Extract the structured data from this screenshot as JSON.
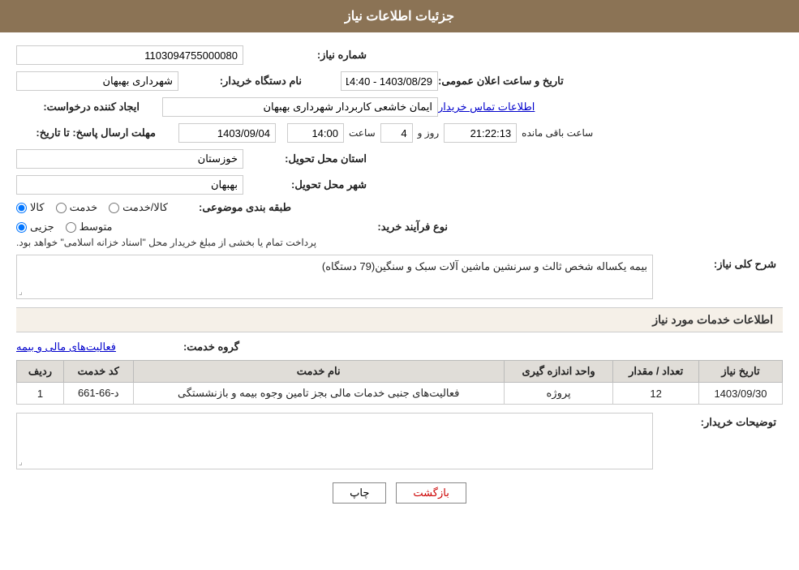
{
  "header": {
    "title": "جزئیات اطلاعات نیاز"
  },
  "fields": {
    "niaaz_number_label": "شماره نیاز:",
    "niaaz_number_value": "1103094755000080",
    "buyer_name_label": "نام دستگاه خریدار:",
    "buyer_name_value": "شهرداری بهبهان",
    "requester_label": "ایجاد کننده درخواست:",
    "requester_value": "ایمان خاشعی کاربردار شهرداری بهبهان",
    "requester_link": "اطلاعات تماس خریدار",
    "announce_date_label": "تاریخ و ساعت اعلان عمومی:",
    "announce_date_value": "1403/08/29 - 14:40",
    "response_deadline_label": "مهلت ارسال پاسخ: تا تاریخ:",
    "response_date_value": "1403/09/04",
    "response_time_label": "ساعت",
    "response_time_value": "14:00",
    "response_days_label": "روز و",
    "response_days_value": "4",
    "response_remaining_label": "ساعت باقی مانده",
    "response_remaining_value": "21:22:13",
    "delivery_province_label": "استان محل تحویل:",
    "delivery_province_value": "خوزستان",
    "delivery_city_label": "شهر محل تحویل:",
    "delivery_city_value": "بهبهان",
    "category_label": "طبقه بندی موضوعی:",
    "category_radio1": "کالا",
    "category_radio2": "خدمت",
    "category_radio3": "کالا/خدمت",
    "category_selected": "کالا",
    "purchase_type_label": "نوع فرآیند خرید:",
    "purchase_radio1": "جزیی",
    "purchase_radio2": "متوسط",
    "purchase_note": "پرداخت تمام یا بخشی از مبلغ خریدار محل \"اسناد خزانه اسلامی\" خواهد بود.",
    "description_label": "شرح کلی نیاز:",
    "description_value": "بیمه یکساله شخص ثالث و سرنشین ماشین آلات سبک و سنگین(79 دستگاه)",
    "services_title": "اطلاعات خدمات مورد نیاز",
    "service_group_label": "گروه خدمت:",
    "service_group_value": "فعالیت‌های مالی و بیمه",
    "table_headers": {
      "row_number": "ردیف",
      "service_code": "کد خدمت",
      "service_name": "نام خدمت",
      "unit": "واحد اندازه گیری",
      "quantity": "تعداد / مقدار",
      "need_date": "تاریخ نیاز"
    },
    "table_rows": [
      {
        "row": "1",
        "code": "د-66-661",
        "name": "فعالیت‌های جنبی خدمات مالی بجز تامین وجوه بیمه و بازنشستگی",
        "unit": "پروژه",
        "quantity": "12",
        "date": "1403/09/30"
      }
    ],
    "buyer_comments_label": "توضیحات خریدار:",
    "buyer_comments_value": ""
  },
  "buttons": {
    "print": "چاپ",
    "back": "بازگشت"
  }
}
